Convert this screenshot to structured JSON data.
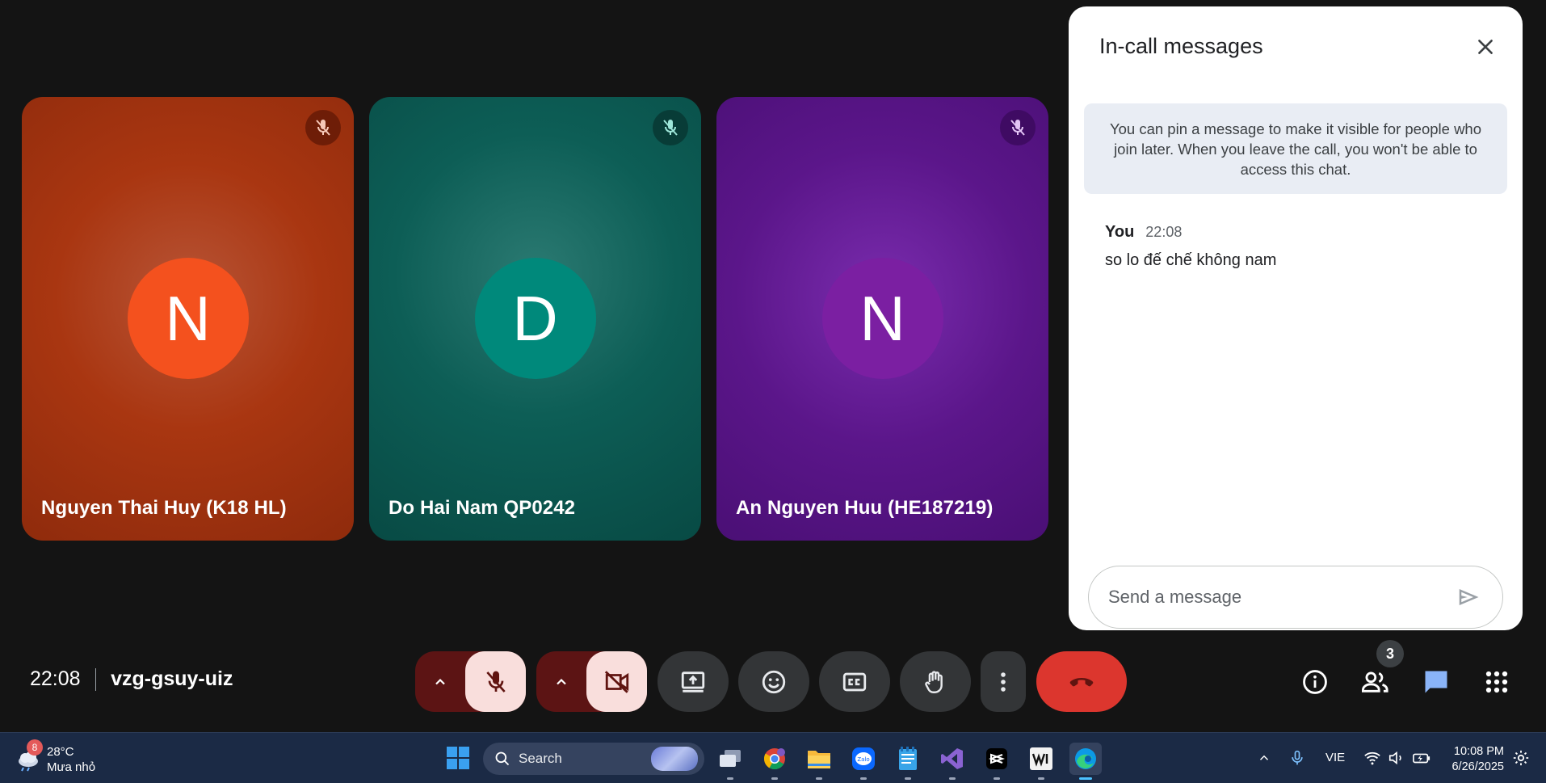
{
  "participants": [
    {
      "initial": "N",
      "name": "Nguyen Thai Huy (K18 HL)"
    },
    {
      "initial": "D",
      "name": "Do Hai Nam QP0242"
    },
    {
      "initial": "N",
      "name": "An Nguyen Huu (HE187219)"
    }
  ],
  "chat": {
    "title": "In-call messages",
    "pin_info": "You can pin a message to make it visible for people who join later. When you leave the call, you won't be able to access this chat.",
    "messages": [
      {
        "sender": "You",
        "time": "22:08",
        "text": "so lo đế chế không nam"
      }
    ],
    "input_placeholder": "Send a message"
  },
  "meeting": {
    "time": "22:08",
    "code": "vzg-gsuy-uiz",
    "participant_count": "3"
  },
  "colors": {
    "tile1": "#a93611",
    "tile2": "#0d5e56",
    "tile3": "#5b168a",
    "avatar1": "#f4511e",
    "avatar2": "#00897b",
    "avatar3": "#7b1fa2",
    "leave": "#dc362e",
    "mic_off_bg": "#f9dedc",
    "chat_active": "#8ab4f8"
  },
  "taskbar": {
    "weather_temp": "28°C",
    "weather_desc": "Mưa nhỏ",
    "weather_badge": "8",
    "search_label": "Search",
    "language": "VIE",
    "clock_time": "10:08 PM",
    "clock_date": "6/26/2025",
    "apps": [
      "task-view-icon",
      "chrome-icon",
      "file-explorer-icon",
      "zalo-icon",
      "notepad-icon",
      "visual-studio-icon",
      "capcut-icon",
      "wix-icon",
      "edge-icon"
    ]
  }
}
